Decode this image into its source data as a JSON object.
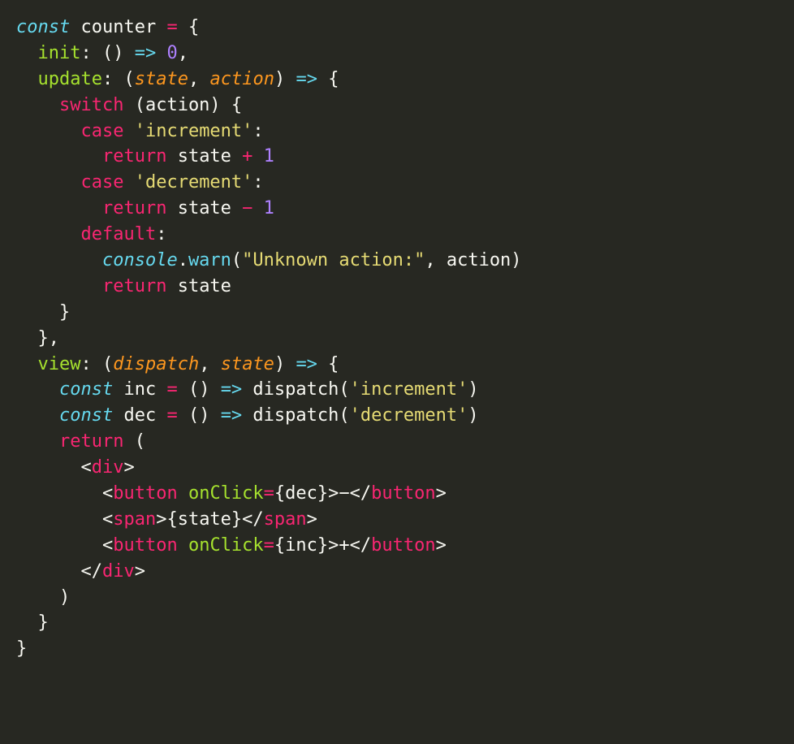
{
  "lines": [
    [
      {
        "c": "kw-decl",
        "t": "const"
      },
      {
        "c": "ident",
        "t": " counter "
      },
      {
        "c": "kw-flow",
        "t": "="
      },
      {
        "c": "punct",
        "t": " {"
      }
    ],
    [
      {
        "c": "punct",
        "t": "  "
      },
      {
        "c": "propname",
        "t": "init"
      },
      {
        "c": "punct",
        "t": ": () "
      },
      {
        "c": "arrow",
        "t": "=>"
      },
      {
        "c": "punct",
        "t": " "
      },
      {
        "c": "num",
        "t": "0"
      },
      {
        "c": "punct",
        "t": ","
      }
    ],
    [
      {
        "c": "punct",
        "t": "  "
      },
      {
        "c": "propname",
        "t": "update"
      },
      {
        "c": "punct",
        "t": ": ("
      },
      {
        "c": "param",
        "t": "state"
      },
      {
        "c": "punct",
        "t": ", "
      },
      {
        "c": "param",
        "t": "action"
      },
      {
        "c": "punct",
        "t": ") "
      },
      {
        "c": "arrow",
        "t": "=>"
      },
      {
        "c": "punct",
        "t": " {"
      }
    ],
    [
      {
        "c": "punct",
        "t": "    "
      },
      {
        "c": "kw-flow",
        "t": "switch"
      },
      {
        "c": "punct",
        "t": " (action) {"
      }
    ],
    [
      {
        "c": "punct",
        "t": "      "
      },
      {
        "c": "kw-flow",
        "t": "case"
      },
      {
        "c": "punct",
        "t": " "
      },
      {
        "c": "str",
        "t": "'increment'"
      },
      {
        "c": "punct",
        "t": ":"
      }
    ],
    [
      {
        "c": "punct",
        "t": "        "
      },
      {
        "c": "kw-flow",
        "t": "return"
      },
      {
        "c": "ident",
        "t": " state "
      },
      {
        "c": "kw-flow",
        "t": "+"
      },
      {
        "c": "punct",
        "t": " "
      },
      {
        "c": "num",
        "t": "1"
      }
    ],
    [
      {
        "c": "punct",
        "t": "      "
      },
      {
        "c": "kw-flow",
        "t": "case"
      },
      {
        "c": "punct",
        "t": " "
      },
      {
        "c": "str",
        "t": "'decrement'"
      },
      {
        "c": "punct",
        "t": ":"
      }
    ],
    [
      {
        "c": "punct",
        "t": "        "
      },
      {
        "c": "kw-flow",
        "t": "return"
      },
      {
        "c": "ident",
        "t": " state "
      },
      {
        "c": "kw-flow",
        "t": "−"
      },
      {
        "c": "punct",
        "t": " "
      },
      {
        "c": "num",
        "t": "1"
      }
    ],
    [
      {
        "c": "punct",
        "t": "      "
      },
      {
        "c": "kw-flow",
        "t": "default"
      },
      {
        "c": "punct",
        "t": ":"
      }
    ],
    [
      {
        "c": "punct",
        "t": "        "
      },
      {
        "c": "obj",
        "t": "console"
      },
      {
        "c": "punct",
        "t": "."
      },
      {
        "c": "method",
        "t": "warn"
      },
      {
        "c": "punct",
        "t": "("
      },
      {
        "c": "str",
        "t": "\"Unknown action:\""
      },
      {
        "c": "punct",
        "t": ", action)"
      }
    ],
    [
      {
        "c": "punct",
        "t": "        "
      },
      {
        "c": "kw-flow",
        "t": "return"
      },
      {
        "c": "ident",
        "t": " state"
      }
    ],
    [
      {
        "c": "punct",
        "t": "    }"
      }
    ],
    [
      {
        "c": "punct",
        "t": "  },"
      }
    ],
    [
      {
        "c": "punct",
        "t": "  "
      },
      {
        "c": "propname",
        "t": "view"
      },
      {
        "c": "punct",
        "t": ": ("
      },
      {
        "c": "param",
        "t": "dispatch"
      },
      {
        "c": "punct",
        "t": ", "
      },
      {
        "c": "param",
        "t": "state"
      },
      {
        "c": "punct",
        "t": ") "
      },
      {
        "c": "arrow",
        "t": "=>"
      },
      {
        "c": "punct",
        "t": " {"
      }
    ],
    [
      {
        "c": "punct",
        "t": "    "
      },
      {
        "c": "kw-decl",
        "t": "const"
      },
      {
        "c": "ident",
        "t": " inc "
      },
      {
        "c": "kw-flow",
        "t": "="
      },
      {
        "c": "punct",
        "t": " () "
      },
      {
        "c": "arrow",
        "t": "=>"
      },
      {
        "c": "ident",
        "t": " dispatch("
      },
      {
        "c": "str",
        "t": "'increment'"
      },
      {
        "c": "punct",
        "t": ")"
      }
    ],
    [
      {
        "c": "punct",
        "t": "    "
      },
      {
        "c": "kw-decl",
        "t": "const"
      },
      {
        "c": "ident",
        "t": " dec "
      },
      {
        "c": "kw-flow",
        "t": "="
      },
      {
        "c": "punct",
        "t": " () "
      },
      {
        "c": "arrow",
        "t": "=>"
      },
      {
        "c": "ident",
        "t": " dispatch("
      },
      {
        "c": "str",
        "t": "'decrement'"
      },
      {
        "c": "punct",
        "t": ")"
      }
    ],
    [
      {
        "c": "punct",
        "t": "    "
      },
      {
        "c": "kw-flow",
        "t": "return"
      },
      {
        "c": "punct",
        "t": " ("
      }
    ],
    [
      {
        "c": "punct",
        "t": "      "
      },
      {
        "c": "tagbr",
        "t": "<"
      },
      {
        "c": "tagname",
        "t": "div"
      },
      {
        "c": "tagbr",
        "t": ">"
      }
    ],
    [
      {
        "c": "punct",
        "t": "        "
      },
      {
        "c": "tagbr",
        "t": "<"
      },
      {
        "c": "tagname",
        "t": "button"
      },
      {
        "c": "punct",
        "t": " "
      },
      {
        "c": "attr",
        "t": "onClick"
      },
      {
        "c": "kw-flow",
        "t": "="
      },
      {
        "c": "jsxexpr",
        "t": "{dec}"
      },
      {
        "c": "tagbr",
        "t": ">"
      },
      {
        "c": "ident",
        "t": "−"
      },
      {
        "c": "tagbr",
        "t": "</"
      },
      {
        "c": "tagname",
        "t": "button"
      },
      {
        "c": "tagbr",
        "t": ">"
      }
    ],
    [
      {
        "c": "punct",
        "t": "        "
      },
      {
        "c": "tagbr",
        "t": "<"
      },
      {
        "c": "tagname",
        "t": "span"
      },
      {
        "c": "tagbr",
        "t": ">"
      },
      {
        "c": "jsxexpr",
        "t": "{state}"
      },
      {
        "c": "tagbr",
        "t": "</"
      },
      {
        "c": "tagname",
        "t": "span"
      },
      {
        "c": "tagbr",
        "t": ">"
      }
    ],
    [
      {
        "c": "punct",
        "t": "        "
      },
      {
        "c": "tagbr",
        "t": "<"
      },
      {
        "c": "tagname",
        "t": "button"
      },
      {
        "c": "punct",
        "t": " "
      },
      {
        "c": "attr",
        "t": "onClick"
      },
      {
        "c": "kw-flow",
        "t": "="
      },
      {
        "c": "jsxexpr",
        "t": "{inc}"
      },
      {
        "c": "tagbr",
        "t": ">"
      },
      {
        "c": "ident",
        "t": "+"
      },
      {
        "c": "tagbr",
        "t": "</"
      },
      {
        "c": "tagname",
        "t": "button"
      },
      {
        "c": "tagbr",
        "t": ">"
      }
    ],
    [
      {
        "c": "punct",
        "t": "      "
      },
      {
        "c": "tagbr",
        "t": "</"
      },
      {
        "c": "tagname",
        "t": "div"
      },
      {
        "c": "tagbr",
        "t": ">"
      }
    ],
    [
      {
        "c": "punct",
        "t": "    )"
      }
    ],
    [
      {
        "c": "punct",
        "t": "  }"
      }
    ],
    [
      {
        "c": "punct",
        "t": "}"
      }
    ]
  ]
}
